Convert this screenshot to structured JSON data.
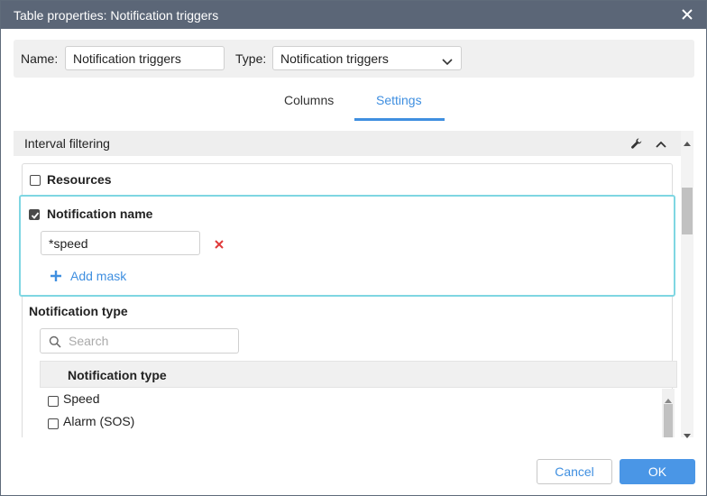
{
  "window": {
    "title": "Table properties: Notification triggers"
  },
  "header": {
    "name_label": "Name:",
    "name_value": "Notification triggers",
    "type_label": "Type:",
    "type_value": "Notification triggers"
  },
  "tabs": [
    {
      "label": "Columns",
      "active": false
    },
    {
      "label": "Settings",
      "active": true
    }
  ],
  "section": {
    "title": "Interval filtering",
    "resources": {
      "label": "Resources",
      "checked": false
    },
    "notification_name": {
      "label": "Notification name",
      "checked": true,
      "mask_value": "*speed",
      "add_mask_label": "Add mask"
    },
    "notification_type": {
      "title": "Notification type",
      "search_placeholder": "Search",
      "column_header": "Notification type",
      "rows": [
        {
          "label": "Speed",
          "checked": false
        },
        {
          "label": "Alarm (SOS)",
          "checked": false
        }
      ]
    }
  },
  "footer": {
    "cancel_label": "Cancel",
    "ok_label": "OK"
  },
  "colors": {
    "accent": "#3f8fe0",
    "titlebar": "#5b6677",
    "highlight": "#7fd6e2",
    "remove": "#e03a3a"
  }
}
